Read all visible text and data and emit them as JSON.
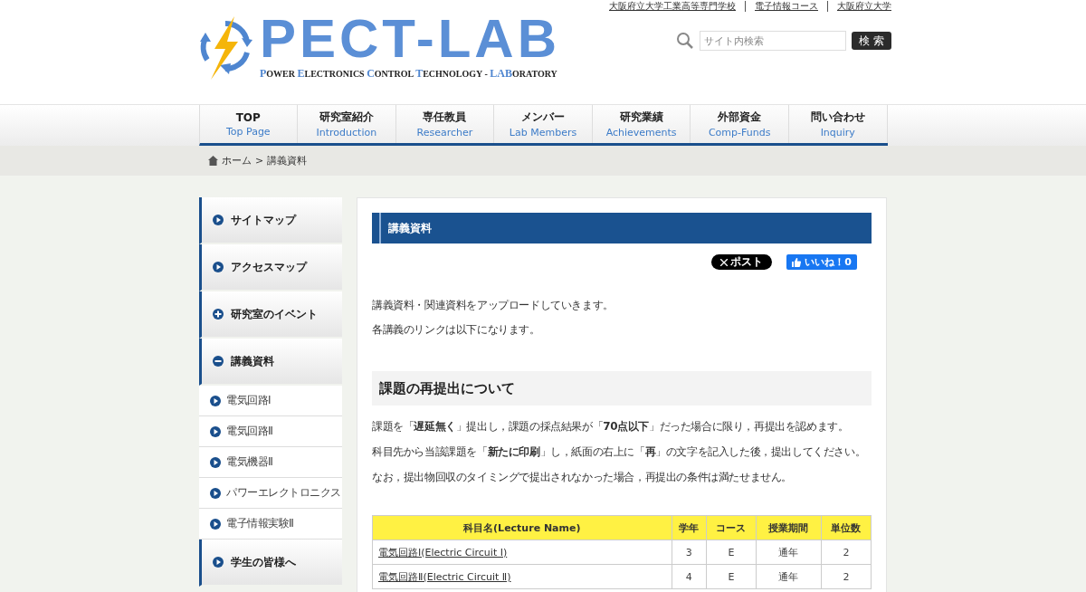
{
  "top_links": [
    "大阪府立大学工業高等専門学校",
    "電子情報コース",
    "大阪府立大学"
  ],
  "logo": {
    "title": "PECT-LAB",
    "subtitle": [
      {
        "text": "P",
        "accent": true
      },
      {
        "text": "OWER ",
        "accent": false
      },
      {
        "text": "E",
        "accent": true
      },
      {
        "text": "LECTRONICS ",
        "accent": false
      },
      {
        "text": "C",
        "accent": true
      },
      {
        "text": "ONTROL ",
        "accent": false
      },
      {
        "text": "T",
        "accent": true
      },
      {
        "text": "ECHNOLOGY - ",
        "accent": false
      },
      {
        "text": "LAB",
        "accent": true
      },
      {
        "text": "ORATORY",
        "accent": false
      }
    ]
  },
  "search": {
    "placeholder": "サイト内検索",
    "button": "検 索"
  },
  "nav": [
    {
      "label": "TOP",
      "sublabel": "Top Page"
    },
    {
      "label": "研究室紹介",
      "sublabel": "Introduction"
    },
    {
      "label": "専任教員",
      "sublabel": "Researcher"
    },
    {
      "label": "メンバー",
      "sublabel": "Lab Members"
    },
    {
      "label": "研究業績",
      "sublabel": "Achievements"
    },
    {
      "label": "外部資金",
      "sublabel": "Comp-Funds"
    },
    {
      "label": "問い合わせ",
      "sublabel": "Inquiry"
    }
  ],
  "breadcrumb": [
    "ホーム",
    ">",
    "講義資料"
  ],
  "sidebar": {
    "items": [
      {
        "label": "サイトマップ",
        "kind": "link"
      },
      {
        "label": "アクセスマップ",
        "kind": "link"
      },
      {
        "label": "研究室のイベント",
        "kind": "group",
        "expanded": false
      },
      {
        "label": "講義資料",
        "kind": "group",
        "expanded": true,
        "children": [
          {
            "label": "電気回路Ⅰ"
          },
          {
            "label": "電気回路Ⅱ"
          },
          {
            "label": "電気機器Ⅱ"
          },
          {
            "label": "パワーエレクトロニクス"
          },
          {
            "label": "電子情報実験Ⅱ"
          }
        ]
      },
      {
        "label": "学生の皆様へ",
        "kind": "link"
      }
    ]
  },
  "page_title": "講義資料",
  "share": {
    "post": "ポスト",
    "like": "いいね！0"
  },
  "intro": [
    "講義資料・関連資料をアップロードしていきます。",
    "各講義のリンクは以下になります。"
  ],
  "section": {
    "title": "課題の再提出について",
    "paragraphs": [
      "課題を「**遅延無く**」提出し，課題の採点結果が「**70点以下**」だった場合に限り，再提出を認めます。",
      "科目先から当該課題を「**新たに印刷**」し，紙面の右上に「**再**」の文字を記入した後，提出してください。",
      "なお，提出物回収のタイミングで提出されなかった場合，再提出の条件は満たせません。"
    ]
  },
  "table": {
    "columns": [
      "科目名(Lecture Name)",
      "学年",
      "コース",
      "授業期間",
      "単位数"
    ],
    "rows": [
      [
        "電気回路Ⅰ(Electric Circuit Ⅰ)",
        "3",
        "E",
        "通年",
        "2"
      ],
      [
        "電気回路Ⅱ(Electric Circuit Ⅱ)",
        "4",
        "E",
        "通年",
        "2"
      ]
    ]
  }
}
